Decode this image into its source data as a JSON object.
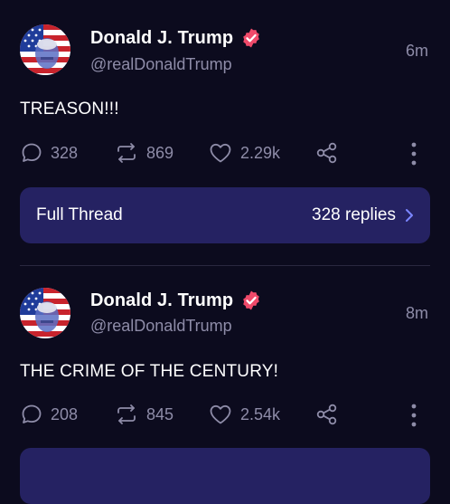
{
  "posts": [
    {
      "author": "Donald J. Trump",
      "handle": "@realDonaldTrump",
      "time": "6m",
      "text": "TREASON!!!",
      "replies": "328",
      "reposts": "869",
      "likes": "2.29k",
      "thread_label": "Full Thread",
      "thread_replies": "328 replies"
    },
    {
      "author": "Donald J. Trump",
      "handle": "@realDonaldTrump",
      "time": "8m",
      "text": "THE CRIME OF THE CENTURY!",
      "replies": "208",
      "reposts": "845",
      "likes": "2.54k"
    }
  ],
  "icons": {
    "verified": "verified-badge-icon",
    "reply": "reply-bubble-icon",
    "repost": "repost-arrows-icon",
    "like": "heart-icon",
    "share": "share-icon",
    "more": "more-vertical-icon",
    "chevron": "chevron-right-icon"
  },
  "colors": {
    "background": "#0c0b1e",
    "muted": "#8e8ca8",
    "verified": "#ef4a6a",
    "thread_bg": "#252262",
    "accent": "#7b86ff"
  }
}
